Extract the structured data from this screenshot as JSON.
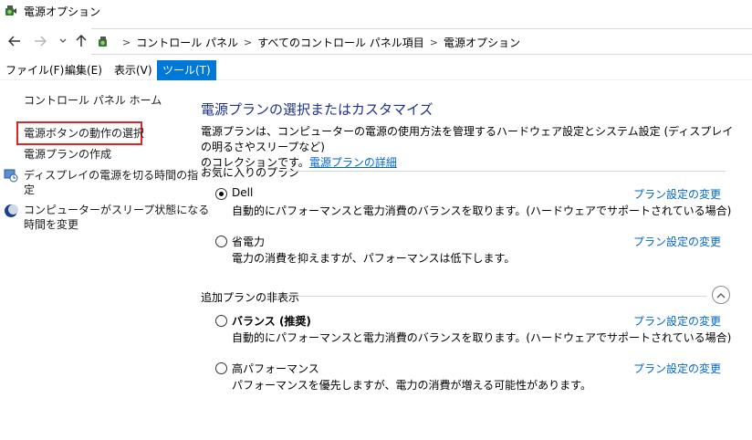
{
  "window": {
    "title": "電源オプション"
  },
  "address": {
    "crumbs": [
      "コントロール パネル",
      "すべてのコントロール パネル項目",
      "電源オプション"
    ]
  },
  "menu": [
    "ファイル(F)",
    "編集(E)",
    "表示(V)",
    "ツール(T)"
  ],
  "left": {
    "home": "コントロール パネル ホーム",
    "power_button": "電源ボタンの動作の選択",
    "create_plan": "電源プランの作成",
    "display_off_1": "ディスプレイの電源を切る時間の指",
    "display_off_2": "定",
    "sleep_1": "コンピューターがスリープ状態になる",
    "sleep_2": "時間を変更"
  },
  "main": {
    "title": "電源プランの選択またはカスタマイズ",
    "desc_1": "電源プランは、コンピューターの電源の使用方法を管理するハードウェア設定とシステム設定 (ディスプレイの明るさやスリープなど)",
    "desc_2": "のコレクションです。",
    "desc_link": "電源プランの詳細",
    "favorites_heading": "お気に入りのプラン",
    "hidden_heading": "追加プランの非表示",
    "change_link": "プラン設定の変更",
    "plans": [
      {
        "name": "Dell",
        "desc": "自動的にパフォーマンスと電力消費のバランスを取ります。(ハードウェアでサポートされている場合)",
        "selected": true
      },
      {
        "name": "省電力",
        "desc": "電力の消費を抑えますが、パフォーマンスは低下します。",
        "selected": false
      },
      {
        "name": "バランス (推奨)",
        "desc": "自動的にパフォーマンスと電力消費のバランスを取ります。(ハードウェアでサポートされている場合)",
        "selected": false
      },
      {
        "name": "高パフォーマンス",
        "desc": "パフォーマンスを優先しますが、電力の消費が増える可能性があります。",
        "selected": false
      }
    ]
  },
  "icons": {
    "app": "power-options-icon",
    "back": "back-arrow-icon",
    "forward": "forward-arrow-icon",
    "recent": "chevron-down-icon",
    "up": "up-arrow-icon",
    "display": "display-clock-icon",
    "sleep": "moon-icon",
    "collapse": "chevron-up-icon"
  },
  "colors": {
    "accent": "#0078d7",
    "link": "#0066cc",
    "title": "#1e3287",
    "highlight": "#e02424"
  }
}
